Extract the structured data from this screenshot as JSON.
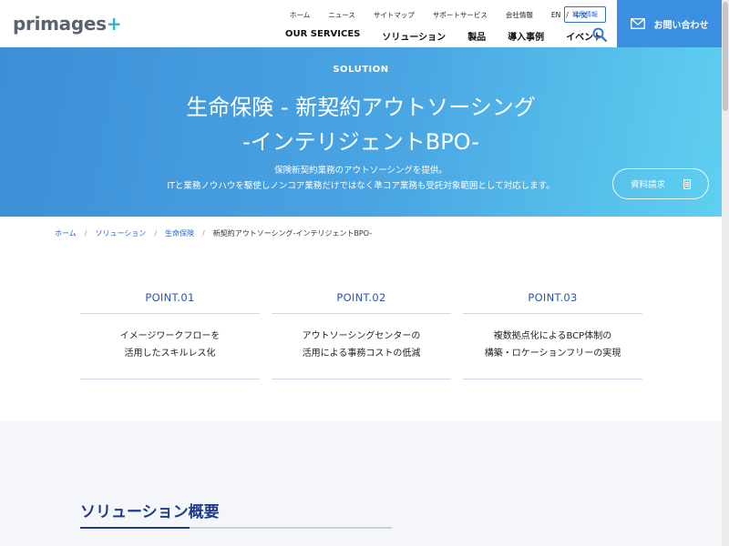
{
  "header": {
    "logo_main": "primages",
    "logo_plus": "+",
    "util_nav": [
      "ホーム",
      "ニュース",
      "サイトマップ",
      "サポートサービス",
      "会社情報"
    ],
    "lang_en": "EN",
    "lang_sep": "/",
    "lang_zh": "中文",
    "recruit": "採用情報",
    "main_nav": [
      "OUR SERVICES",
      "ソリューション",
      "製品",
      "導入事例",
      "イベント"
    ],
    "contact": "お問い合わせ"
  },
  "hero": {
    "kicker": "SOLUTION",
    "title_line1": "生命保険 - 新契約アウトソーシング",
    "title_line2": "-インテリジェントBPO-",
    "desc_line1": "保険新契約業務のアウトソーシングを提供。",
    "desc_line2": "ITと業務ノウハウを駆使しノンコア業務だけではなく準コア業務も受託対象範囲として対応します。",
    "doc_button": "資料請求"
  },
  "breadcrumb": {
    "items": [
      "ホーム",
      "ソリューション",
      "生命保険"
    ],
    "current": "新契約アウトソーシング-インテリジェントBPO-",
    "sep": "/"
  },
  "points": [
    {
      "title": "POINT.01",
      "line1": "イメージワークフローを",
      "line2": "活用したスキルレス化"
    },
    {
      "title": "POINT.02",
      "line1": "アウトソーシングセンターの",
      "line2": "活用による事務コストの低減"
    },
    {
      "title": "POINT.03",
      "line1": "複数拠点化によるBCP体制の",
      "line2": "構築・ロケーションフリーの実現"
    }
  ],
  "overview": {
    "heading": "ソリューション概要"
  }
}
